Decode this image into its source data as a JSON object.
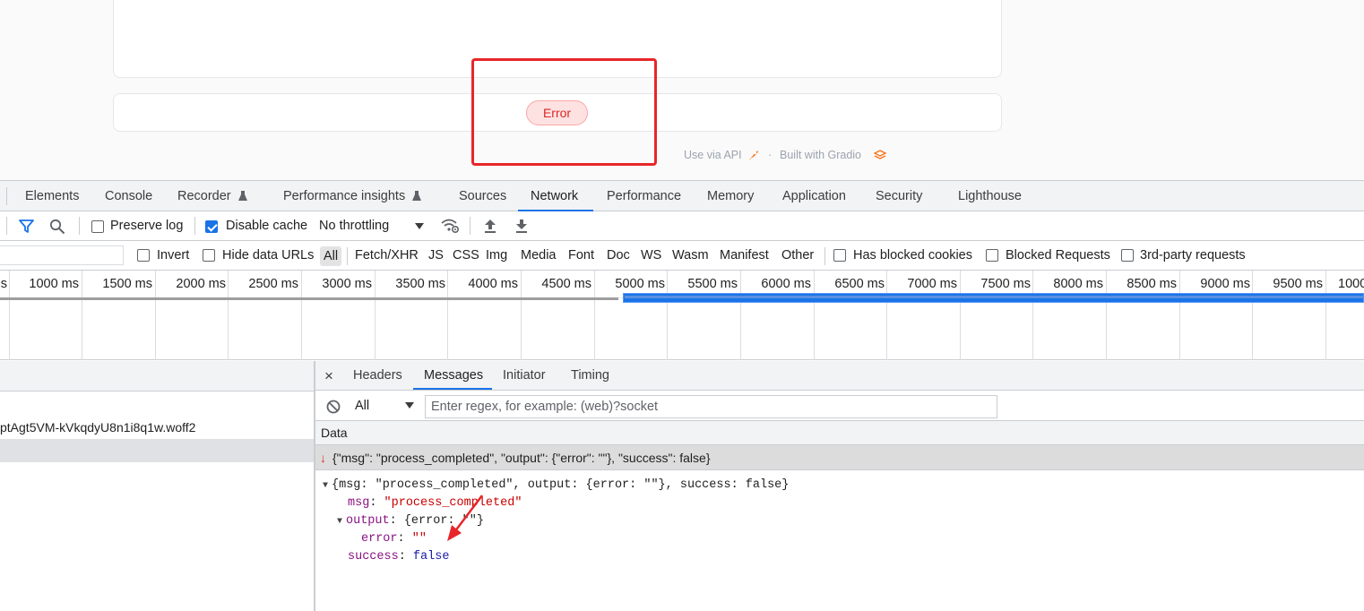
{
  "gradio": {
    "status_badge": "Error",
    "use_via_api": "Use via API",
    "dot": "·",
    "built_with": "Built with Gradio"
  },
  "devtools_tabs": [
    {
      "label": "Elements"
    },
    {
      "label": "Console"
    },
    {
      "label": "Recorder"
    },
    {
      "label": "Performance insights"
    },
    {
      "label": "Sources"
    },
    {
      "label": "Network",
      "active": true
    },
    {
      "label": "Performance"
    },
    {
      "label": "Memory"
    },
    {
      "label": "Application"
    },
    {
      "label": "Security"
    },
    {
      "label": "Lighthouse"
    }
  ],
  "network_toolbar": {
    "preserve_log": "Preserve log",
    "preserve_log_checked": false,
    "disable_cache": "Disable cache",
    "disable_cache_checked": true,
    "throttling": "No throttling"
  },
  "filter_row": {
    "invert": "Invert",
    "hide_data_urls": "Hide data URLs",
    "types": [
      "All",
      "Fetch/XHR",
      "JS",
      "CSS",
      "Img",
      "Media",
      "Font",
      "Doc",
      "WS",
      "Wasm",
      "Manifest",
      "Other"
    ],
    "has_blocked_cookies": "Has blocked cookies",
    "blocked_requests": "Blocked Requests",
    "third_party": "3rd-party requests"
  },
  "timeline": {
    "labels": [
      "s",
      "1000 ms",
      "1500 ms",
      "2000 ms",
      "2500 ms",
      "3000 ms",
      "3500 ms",
      "4000 ms",
      "4500 ms",
      "5000 ms",
      "5500 ms",
      "6000 ms",
      "6500 ms",
      "7000 ms",
      "7500 ms",
      "8000 ms",
      "8500 ms",
      "9000 ms",
      "9500 ms",
      "1000"
    ]
  },
  "request_list": {
    "rows": [
      "ptAgt5VM-kVkqdyU8n1i8q1w.woff2",
      ""
    ]
  },
  "detail_tabs": {
    "close": "×",
    "tabs": [
      "Headers",
      "Messages",
      "Initiator",
      "Timing"
    ],
    "active": "Messages"
  },
  "messages_filter": {
    "type_value": "All",
    "placeholder": "Enter regex, for example: (web)?socket"
  },
  "messages": {
    "data_header": "Data",
    "row_arrow": "↓",
    "row_text": "{\"msg\": \"process_completed\", \"output\": {\"error\": \"\"}, \"success\": false}",
    "tree": {
      "summary": "{msg: \"process_completed\", output: {error: \"\"}, success: false}",
      "msg_key": "msg",
      "msg_val": "\"process_completed\"",
      "output_key": "output",
      "output_summary": "{error: \"\"}",
      "error_key": "error",
      "error_val": "\"\"",
      "success_key": "success",
      "success_val": "false"
    }
  },
  "colors": {
    "accent": "#1a73e8",
    "error_red": "#dc2626",
    "annotation_red": "#e8262a"
  }
}
